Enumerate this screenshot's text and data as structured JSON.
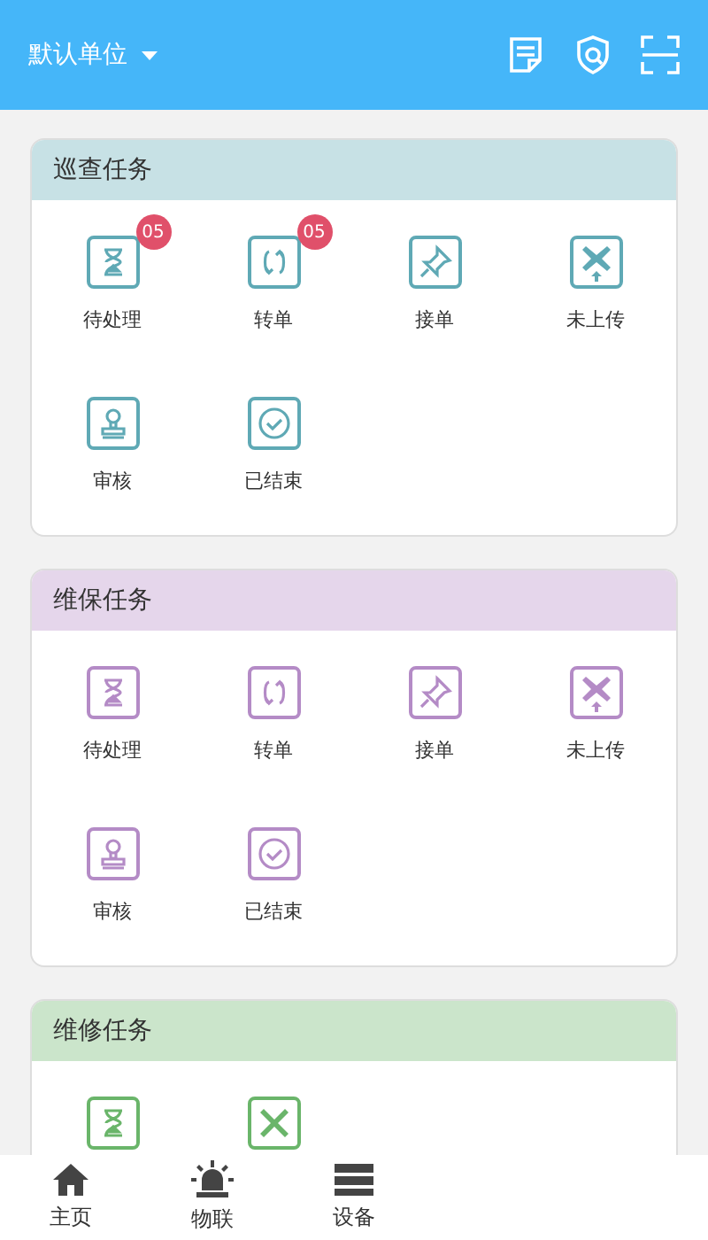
{
  "header": {
    "unit_selector": "默认单位"
  },
  "sections": [
    {
      "title": "巡查任务",
      "color": "#5fa9b5",
      "items": [
        {
          "kind": "hourglass",
          "label": "待处理",
          "badge": "05"
        },
        {
          "kind": "swap",
          "label": "转单",
          "badge": "05"
        },
        {
          "kind": "pin",
          "label": "接单"
        },
        {
          "kind": "upload-x",
          "label": "未上传"
        },
        {
          "kind": "stamp",
          "label": "审核"
        },
        {
          "kind": "check",
          "label": "已结束"
        }
      ]
    },
    {
      "title": "维保任务",
      "color": "#b48bc6",
      "items": [
        {
          "kind": "hourglass",
          "label": "待处理"
        },
        {
          "kind": "swap",
          "label": "转单"
        },
        {
          "kind": "pin",
          "label": "接单"
        },
        {
          "kind": "upload-x",
          "label": "未上传"
        },
        {
          "kind": "stamp",
          "label": "审核"
        },
        {
          "kind": "check",
          "label": "已结束"
        }
      ]
    },
    {
      "title": "维修任务",
      "color": "#6ab56a",
      "items": [
        {
          "kind": "hourglass"
        },
        {
          "kind": "x"
        }
      ]
    }
  ],
  "bottom_nav": [
    {
      "kind": "home",
      "label": "主页"
    },
    {
      "kind": "alarm",
      "label": "物联"
    },
    {
      "kind": "device",
      "label": "设备"
    }
  ]
}
